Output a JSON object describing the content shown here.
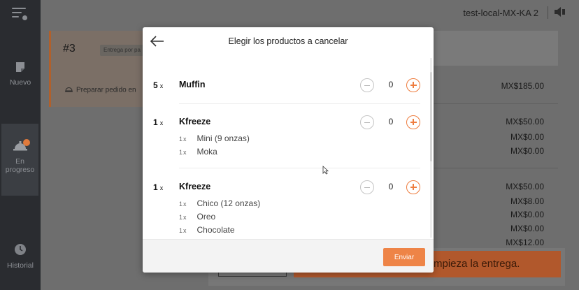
{
  "sidebar": {
    "items": [
      {
        "label": "Nuevo"
      },
      {
        "label": "En progreso"
      },
      {
        "label": "Historial"
      }
    ]
  },
  "topbar": {
    "store_name": "test-local-MX-KA 2"
  },
  "background": {
    "order_number": "#3",
    "order_chip": "Entrega por pa",
    "prepare_text": "Preparar pedido en",
    "prices": [
      "MX$185.00",
      "MX$50.00",
      "MX$0.00",
      "MX$0.00",
      "MX$50.00",
      "MX$8.00",
      "MX$0.00",
      "MX$0.00",
      "MX$12.00"
    ],
    "action_text": "mpieza la entrega."
  },
  "modal": {
    "title": "Elegir los productos a cancelar",
    "qty_suffix": "x",
    "items": [
      {
        "qty": "5",
        "name": "Muffin",
        "value": "0",
        "modifiers": []
      },
      {
        "qty": "1",
        "name": "Kfreeze",
        "value": "0",
        "modifiers": [
          {
            "qty": "1",
            "name": "Mini (9 onzas)"
          },
          {
            "qty": "1",
            "name": "Moka"
          }
        ]
      },
      {
        "qty": "1",
        "name": "Kfreeze",
        "value": "0",
        "modifiers": [
          {
            "qty": "1",
            "name": "Chico (12 onzas)"
          },
          {
            "qty": "1",
            "name": "Oreo"
          },
          {
            "qty": "1",
            "name": "Chocolate"
          }
        ]
      }
    ],
    "submit_label": "Enviar"
  },
  "colors": {
    "accent": "#ee7d3f",
    "sidebar_bg": "#2a2c30",
    "overlay_bg": "#6e6e6e"
  }
}
